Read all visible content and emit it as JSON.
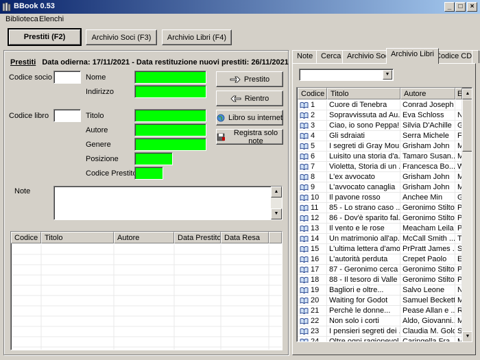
{
  "window": {
    "title": "BBook 0.53",
    "min": "_",
    "max": "□",
    "close": "×"
  },
  "menu": [
    "Biblioteca",
    "Elenchi"
  ],
  "toolbar": {
    "prestiti": "Prestiti (F2)",
    "soci": "Archivio Soci (F3)",
    "libri": "Archivio Libri (F4)"
  },
  "headline": {
    "section": "Prestiti",
    "text": "Data odierna: 17/11/2021 - Data restituzione nuovi prestiti: 26/11/2021"
  },
  "form": {
    "codice_socio": "Codice socio",
    "nome": "Nome",
    "indirizzo": "Indirizzo",
    "codice_libro": "Codice libro",
    "titolo": "Titolo",
    "autore": "Autore",
    "genere": "Genere",
    "posizione": "Posizione",
    "codice_prestito": "Codice Prestito",
    "note": "Note"
  },
  "actions": {
    "prestito": "Prestito",
    "rientro": "Rientro",
    "internet": "Libro su internet",
    "registra": "Registra solo note"
  },
  "loans_table": {
    "headers": [
      "Codice",
      "Titolo",
      "Autore",
      "Data Prestito",
      "Data Resa"
    ]
  },
  "tabs": [
    "Note",
    "Cerca",
    "Archivio Soci",
    "Archivio Libri",
    "Codice CDD"
  ],
  "active_tab": "Archivio Libri",
  "books_table": {
    "headers": [
      "Codice",
      "Titolo",
      "Autore",
      "E"
    ],
    "rows": [
      [
        "1",
        "Cuore di Tenebra",
        "Conrad Joseph",
        ""
      ],
      [
        "2",
        "Sopravvissuta ad Au...",
        "Eva Schloss",
        "N"
      ],
      [
        "3",
        "Ciao, io sono Peppa!",
        "Silvia D'Achille",
        "Gi"
      ],
      [
        "4",
        "Gli sdraiati",
        "Serra Michele",
        "Fe"
      ],
      [
        "5",
        "I segreti di Gray Mou...",
        "Grisham John",
        "M"
      ],
      [
        "6",
        "Luisito una storia d'a...",
        "Tamaro Susan...",
        "M"
      ],
      [
        "7",
        "Violetta, Storia di un ...",
        "Francesca Bo...",
        "W"
      ],
      [
        "8",
        "L'ex avvocato",
        "Grisham John",
        "M"
      ],
      [
        "9",
        "L'avvocato canaglia",
        "Grisham John",
        "M"
      ],
      [
        "10",
        "Il pavone rosso",
        "Anchee Min",
        "Gi"
      ],
      [
        "11",
        "85 - Lo strano caso ...",
        "Geronimo Stilton",
        "Pi"
      ],
      [
        "12",
        "86 - Dov'è sparito fal...",
        "Geronimo Stilton",
        "Pi"
      ],
      [
        "13",
        "Il vento e le rose",
        "Meacham Leila",
        "Pi"
      ],
      [
        "14",
        "Un matrimonio all'ap...",
        "McCall Smith ...",
        "Te"
      ],
      [
        "15",
        "L'ultima lettera d'amore",
        "PrPratt James ...",
        "Sc"
      ],
      [
        "16",
        "L'autorità perduta",
        "Crepet Paolo",
        "Ei"
      ],
      [
        "17",
        "87 - Geronimo cerca ...",
        "Geronimo Stilton",
        "Pi"
      ],
      [
        "18",
        "88 - Il tesoro di Valle ...",
        "Geronimo Stilton",
        "Pi"
      ],
      [
        "19",
        "Bagliori e oltre...",
        "Salvo Leone",
        "Ni"
      ],
      [
        "20",
        "Waiting for Godot",
        "Samuel Beckett",
        "M"
      ],
      [
        "21",
        "Perchè le donne...",
        "Pease Allan e ...",
        "Ri"
      ],
      [
        "22",
        "Non solo i corti",
        "Aldo, Giovanni...",
        "M"
      ],
      [
        "23",
        "I pensieri segreti dei ...",
        "Claudia M. Gold",
        "Sp"
      ],
      [
        "24",
        "Oltre ogni ragionevol...",
        "Caringella Fra...",
        "M"
      ]
    ]
  },
  "colors": {
    "field_green": "#00ff00",
    "titlebar": "#0a246a",
    "face": "#d4d0c8"
  }
}
